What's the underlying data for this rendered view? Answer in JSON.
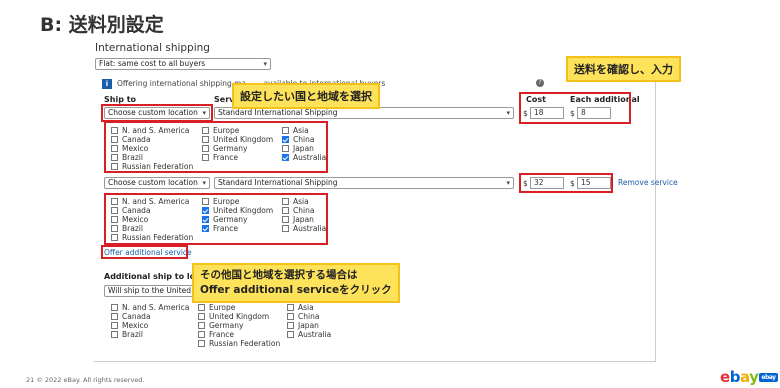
{
  "slide_title": "B: 送料別設定",
  "section_title": "International shipping",
  "cost_type": "Flat: same cost to all buyers",
  "info_text": "Offering international shipping ma…                  …available to international buyers",
  "help_icon": "?",
  "col_ship_to": "Ship to",
  "col_service": "Servic",
  "col_cost": "Cost",
  "col_each": "Each additional",
  "currency": "$",
  "row1": {
    "ship_to": "Choose custom location",
    "service": "Standard International Shipping",
    "cost": "18",
    "each": "8",
    "regions": [
      {
        "label": "N. and S. America",
        "checked": false
      },
      {
        "label": "Canada",
        "checked": false
      },
      {
        "label": "Mexico",
        "checked": false
      },
      {
        "label": "Brazil",
        "checked": false
      },
      {
        "label": "Russian Federation",
        "checked": false
      },
      {
        "label": "Europe",
        "checked": false
      },
      {
        "label": "United Kingdom",
        "checked": false
      },
      {
        "label": "Germany",
        "checked": false
      },
      {
        "label": "France",
        "checked": false
      },
      {
        "label": "Asia",
        "checked": false
      },
      {
        "label": "China",
        "checked": true
      },
      {
        "label": "Japan",
        "checked": false
      },
      {
        "label": "Australia",
        "checked": true
      }
    ]
  },
  "row2": {
    "ship_to": "Choose custom location",
    "service": "Standard International Shipping",
    "cost": "32",
    "each": "15",
    "remove": "Remove service",
    "regions": [
      {
        "label": "N. and S. America",
        "checked": false
      },
      {
        "label": "Canada",
        "checked": false
      },
      {
        "label": "Mexico",
        "checked": false
      },
      {
        "label": "Brazil",
        "checked": false
      },
      {
        "label": "Russian Federation",
        "checked": false
      },
      {
        "label": "Europe",
        "checked": false
      },
      {
        "label": "United Kingdom",
        "checked": true
      },
      {
        "label": "Germany",
        "checked": true
      },
      {
        "label": "France",
        "checked": true
      },
      {
        "label": "Asia",
        "checked": false
      },
      {
        "label": "China",
        "checked": false
      },
      {
        "label": "Japan",
        "checked": false
      },
      {
        "label": "Australia",
        "checked": false
      }
    ]
  },
  "offer_link": "Offer additional service",
  "additional_title": "Additional ship to locat",
  "additional_select": "Will ship to the United S",
  "additional_regions": [
    {
      "label": "N. and S. America",
      "checked": false
    },
    {
      "label": "Canada",
      "checked": false
    },
    {
      "label": "Mexico",
      "checked": false
    },
    {
      "label": "Brazil",
      "checked": false
    },
    {
      "label": "Europe",
      "checked": false
    },
    {
      "label": "United Kingdom",
      "checked": false
    },
    {
      "label": "Germany",
      "checked": false
    },
    {
      "label": "France",
      "checked": false
    },
    {
      "label": "Russian Federation",
      "checked": false
    },
    {
      "label": "Asia",
      "checked": false
    },
    {
      "label": "China",
      "checked": false
    },
    {
      "label": "Japan",
      "checked": false
    },
    {
      "label": "Australia",
      "checked": false
    }
  ],
  "callout_country": "設定したい国と地域を選択",
  "callout_cost": "送料を確認し、入力",
  "callout_offer_line1": "その他国と地域を選択する場合は",
  "callout_offer_line2": "Offer additional serviceをクリック",
  "footer": "21   © 2022 eBay. All rights reserved.",
  "logo": {
    "e": "e",
    "b": "b",
    "a": "a",
    "y": "y",
    "badge": "ebay"
  },
  "colors": {
    "accent_red": "#d81f26",
    "callout_yellow": "#fde25a",
    "link_blue": "#1a5ea8"
  }
}
